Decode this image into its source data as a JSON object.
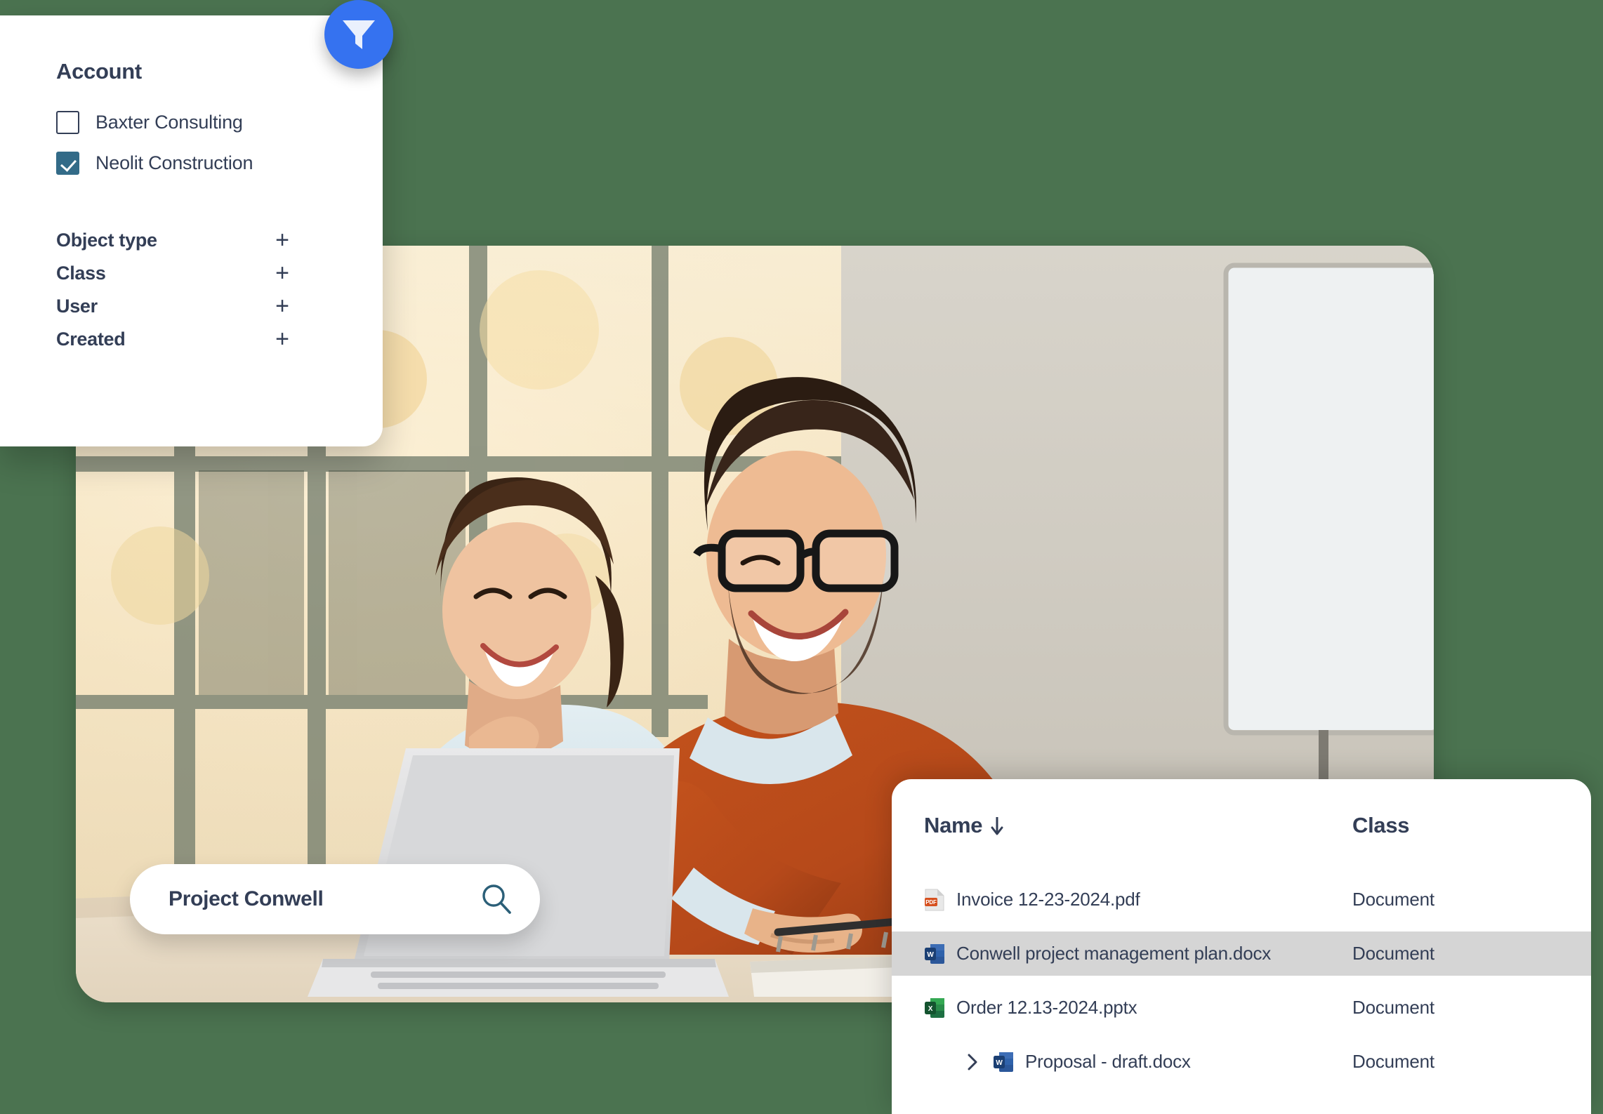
{
  "theme": {
    "background": "#4b7350",
    "accent_blue": "#3572f0",
    "checkbox_checked": "#336b88",
    "text_dark": "#333e56",
    "row_selected": "#d5d5d5",
    "card_white": "#ffffff"
  },
  "filter_panel": {
    "fab_icon": "filter-funnel-icon",
    "account": {
      "title": "Account",
      "options": [
        {
          "label": "Baxter Consulting",
          "checked": false
        },
        {
          "label": "Neolit Construction",
          "checked": true
        }
      ]
    },
    "facets": [
      {
        "label": "Object type",
        "expander": "+"
      },
      {
        "label": "Class",
        "expander": "+"
      },
      {
        "label": "User",
        "expander": "+"
      },
      {
        "label": "Created",
        "expander": "+"
      }
    ]
  },
  "search": {
    "value": "Project Conwell",
    "placeholder": "Search",
    "icon": "search-magnifier-icon"
  },
  "results": {
    "columns": [
      {
        "key": "name",
        "label": "Name",
        "sort": "↓"
      },
      {
        "key": "class",
        "label": "Class",
        "sort": ""
      }
    ],
    "rows": [
      {
        "name": "Invoice 12-23-2024.pdf",
        "class": "Document",
        "icon": "pdf-file-icon",
        "selected": false,
        "indented": false,
        "expandable": false
      },
      {
        "name": "Conwell project management plan.docx",
        "class": "Document",
        "icon": "word-file-icon",
        "selected": true,
        "indented": false,
        "expandable": false
      },
      {
        "name": "Order 12.13-2024.pptx",
        "class": "Document",
        "icon": "excel-file-icon",
        "selected": false,
        "indented": false,
        "expandable": false
      },
      {
        "name": "Proposal - draft.docx",
        "class": "Document",
        "icon": "word-file-icon",
        "selected": false,
        "indented": true,
        "expandable": true
      }
    ]
  },
  "photo": {
    "alt": "Two colleagues smiling at a laptop in a bright office"
  }
}
